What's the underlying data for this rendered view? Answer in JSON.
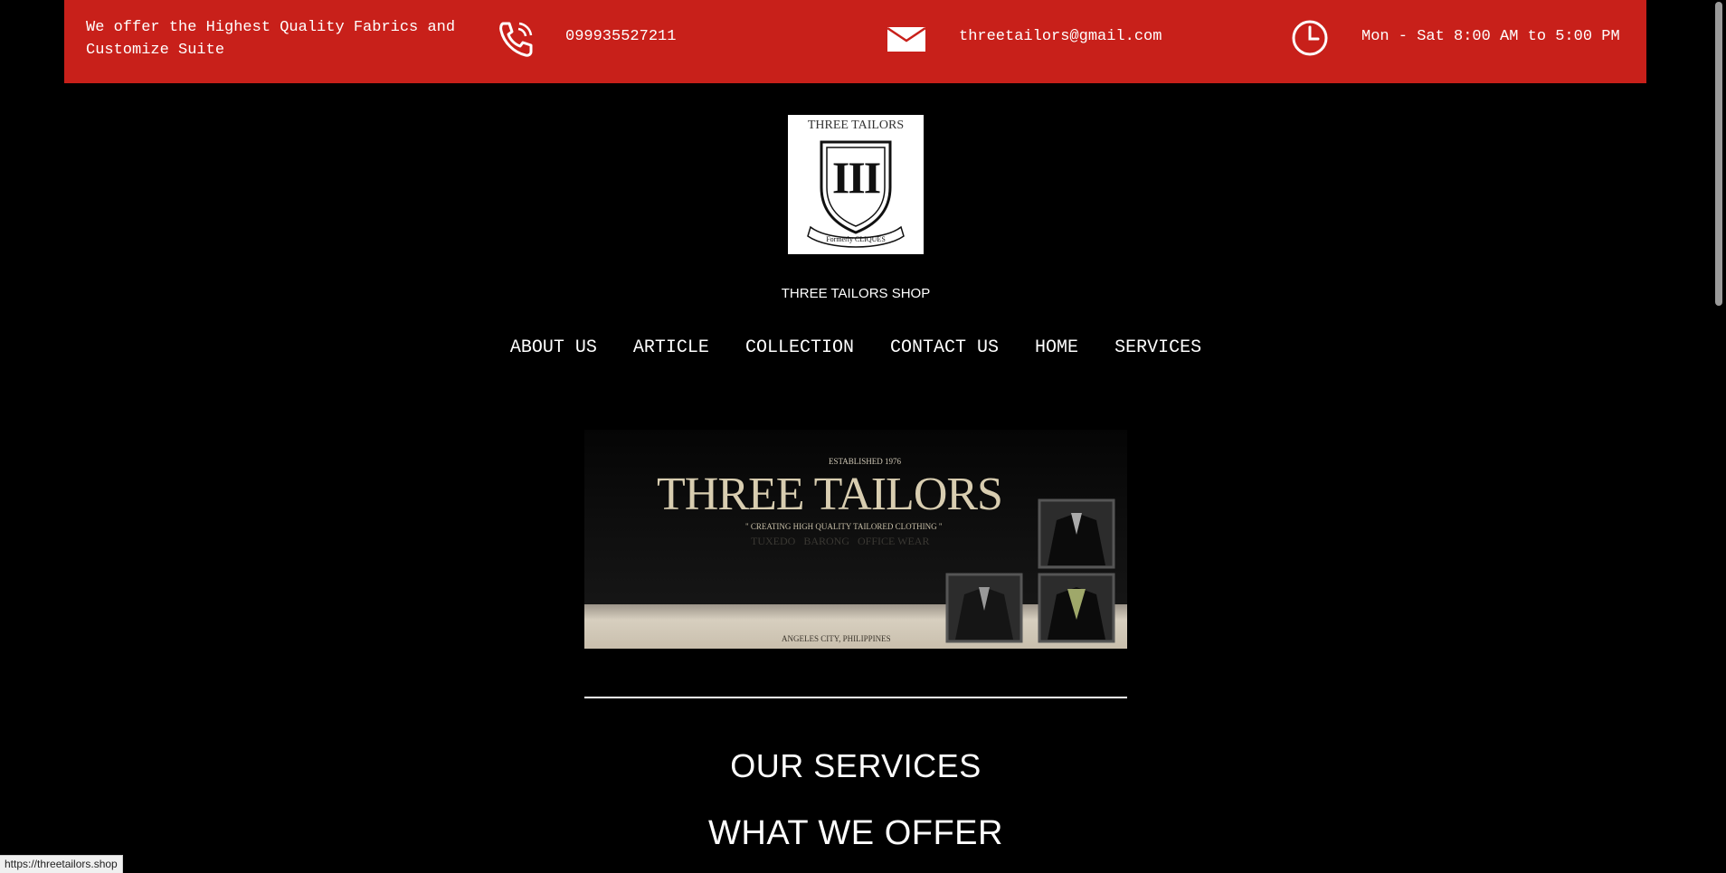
{
  "topbar": {
    "tagline": "We offer the Highest Quality Fabrics and Customize Suite",
    "phone": "099935527211",
    "email": "threetailors@gmail.com",
    "hours": "Mon - Sat 8:00 AM to 5:00 PM",
    "icons": [
      "phone-icon",
      "mail-icon",
      "clock-icon"
    ],
    "background_color": "#c8201a"
  },
  "logo": {
    "title": "THREE TAILORS",
    "emblem": "III",
    "ribbon": "Formerly CLIQUES"
  },
  "shop_name": "THREE TAILORS SHOP",
  "nav": {
    "items": [
      {
        "label": "ABOUT US"
      },
      {
        "label": "ARTICLE"
      },
      {
        "label": "COLLECTION"
      },
      {
        "label": "CONTACT US"
      },
      {
        "label": "HOME"
      },
      {
        "label": "SERVICES"
      }
    ]
  },
  "banner": {
    "established": "ESTABLISHED 1976",
    "title": "THREE TAILORS",
    "tagline": "\" CREATING HIGH QUALITY TAILORED CLOTHING \"",
    "categories": "TUXEDO   BARONG   OFFICE WEAR",
    "location": "ANGELES CITY, PHILIPPINES"
  },
  "sections": {
    "services_heading": "OUR SERVICES",
    "offer_heading": "WHAT WE OFFER"
  },
  "status_url": "https://threetailors.shop"
}
